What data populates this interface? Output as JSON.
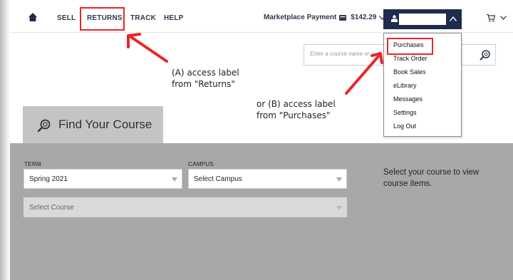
{
  "nav": {
    "items": [
      "SELL",
      "RETURNS",
      "TRACK",
      "HELP"
    ],
    "marketplace_label": "Marketplace Payment",
    "marketplace_amount": "$142.29"
  },
  "user_menu": {
    "items": [
      "Purchases",
      "Track Order",
      "Book Sales",
      "eLibrary",
      "Messages",
      "Settings",
      "Log Out"
    ]
  },
  "search": {
    "placeholder": "Enter a course name or"
  },
  "annotations": {
    "a_line1": "(A) access label",
    "a_line2": "from \"Returns\"",
    "b_line1": "or (B) access label",
    "b_line2": "from \"Purchases\""
  },
  "find_course": {
    "title": "Find Your Course",
    "term_label": "TERM",
    "term_value": "Spring 2021",
    "campus_label": "CAMPUS",
    "campus_value": "Select Campus",
    "course_value": "Select Course",
    "info": "Select your course to view course items."
  },
  "colors": {
    "nav_dark": "#1d2b4c",
    "highlight_red": "#e8262a",
    "panel_gray": "#a8a8a8"
  },
  "icons": [
    "home-icon",
    "wallet-icon",
    "chevron-down-icon",
    "user-icon",
    "chevron-up-icon",
    "cart-icon",
    "search-icon"
  ]
}
